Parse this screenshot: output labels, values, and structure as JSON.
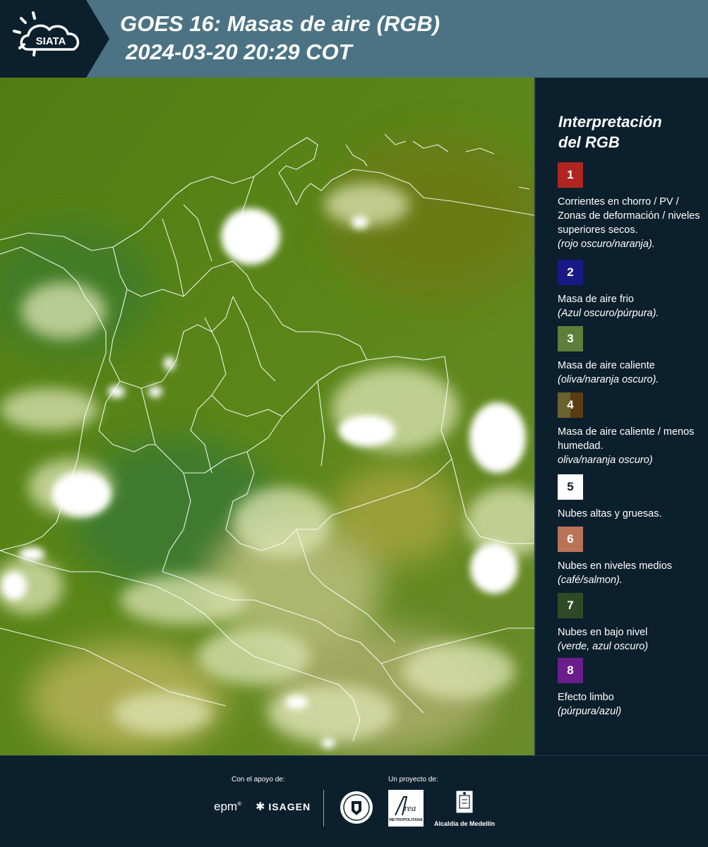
{
  "header": {
    "logo_text": "SIATA",
    "title_line1": "GOES 16: Masas de aire (RGB)",
    "title_line2": "2024-03-20 20:29 COT"
  },
  "legend": {
    "title_line1": "Interpretación",
    "title_line2": "del RGB",
    "items": [
      {
        "number": "1",
        "color": "#b02522",
        "text": "Corrientes en chorro / PV / Zonas de deformación / niveles superiores secos.",
        "note": "(rojo oscuro/naranja)."
      },
      {
        "number": "2",
        "color": "#191985",
        "text": "Masa de aire frio",
        "note": "(Azul oscuro/púrpura)."
      },
      {
        "number": "3",
        "color": "#5d7f3a",
        "text": "Masa de aire caliente",
        "note": "(oliva/naranja oscuro)."
      },
      {
        "number": "4",
        "color": "#6b6230",
        "color2": "#5a3b12",
        "text": "Masa de aire caliente / menos humedad.",
        "note": "oliva/naranja oscuro)"
      },
      {
        "number": "5",
        "color": "#ffffff",
        "text": "Nubes altas y gruesas.",
        "note": ""
      },
      {
        "number": "6",
        "color": "#b97458",
        "text": "Nubes en niveles medios",
        "note": "(café/salmon)."
      },
      {
        "number": "7",
        "color": "#2e4a24",
        "text": "Nubes en bajo nivel",
        "note": "(verde, azul oscuro)"
      },
      {
        "number": "8",
        "color": "#6a1e8c",
        "text": "Efecto limbo",
        "note": "(púrpura/azul)"
      }
    ]
  },
  "footer": {
    "support_label": "Con el apoyo de:",
    "project_label": "Un proyecto de:",
    "epm": "epm",
    "isagen": "ISAGEN",
    "metro_text": "METROPOLITANA",
    "alcaldia": "Alcaldía de Medellín"
  }
}
